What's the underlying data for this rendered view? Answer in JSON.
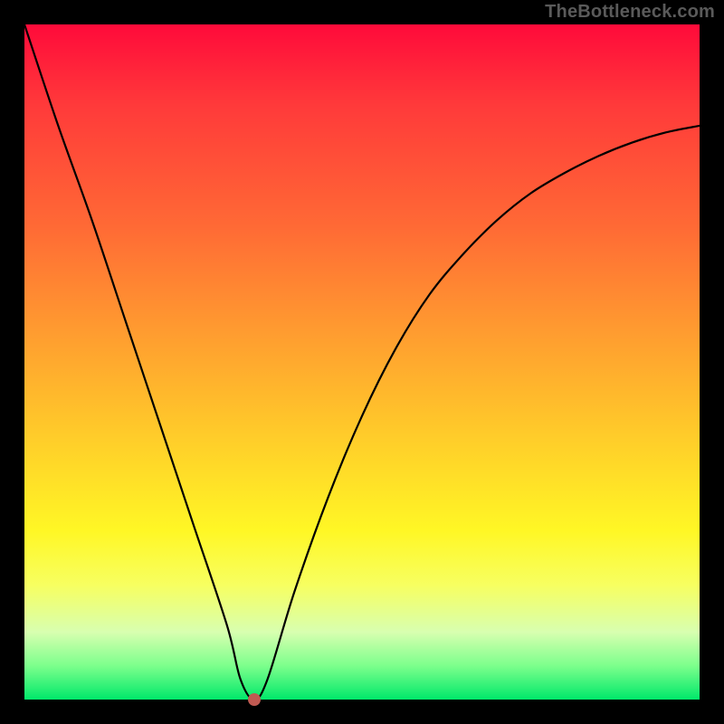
{
  "watermark": "TheBottleneck.com",
  "colors": {
    "background": "#000000",
    "curve": "#000000",
    "marker": "#c05a52",
    "gradient_stops": [
      "#ff0a3a",
      "#ff3a3a",
      "#ff6a35",
      "#ff9a30",
      "#ffc92a",
      "#fff725",
      "#f7ff60",
      "#d8ffb0",
      "#7cff8c",
      "#00e86a"
    ]
  },
  "chart_data": {
    "type": "line",
    "title": "",
    "xlabel": "",
    "ylabel": "",
    "xlim": [
      0,
      100
    ],
    "ylim": [
      0,
      100
    ],
    "grid": false,
    "marker": {
      "x": 34,
      "y": 0
    },
    "series": [
      {
        "name": "curve",
        "x": [
          0,
          5,
          10,
          15,
          20,
          25,
          30,
          32,
          34,
          36,
          40,
          45,
          50,
          55,
          60,
          65,
          70,
          75,
          80,
          85,
          90,
          95,
          100
        ],
        "y": [
          100,
          85,
          71,
          56,
          41,
          26,
          11,
          3,
          0,
          3,
          16,
          30,
          42,
          52,
          60,
          66,
          71,
          75,
          78,
          80.5,
          82.5,
          84,
          85
        ]
      }
    ]
  }
}
